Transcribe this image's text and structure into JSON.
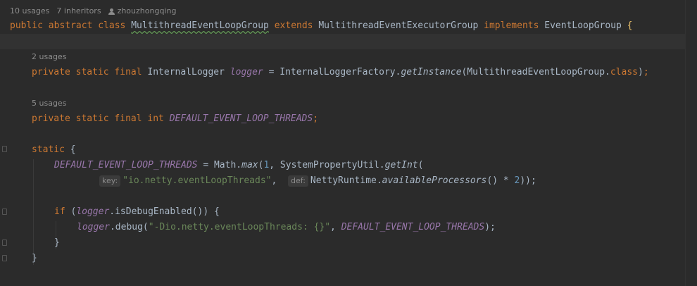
{
  "class_hint": {
    "usages": "10 usages",
    "inheritors": "7 inheritors",
    "author": "zhouzhongqing"
  },
  "class_decl": {
    "kw_public": "public",
    "kw_abstract": "abstract",
    "kw_class": "class",
    "class_name": "MultithreadEventLoopGroup",
    "kw_extends": "extends",
    "super_class": "MultithreadEventExecutorGroup",
    "kw_implements": "implements",
    "interface_name": "EventLoopGroup",
    "brace": "{"
  },
  "logger_field": {
    "hint": "2 usages",
    "kw_private": "private",
    "kw_static": "static",
    "kw_final": "final",
    "type": "InternalLogger",
    "name": "logger",
    "eq": " = ",
    "factory": "InternalLoggerFactory.",
    "method": "getInstance",
    "args_pre": "(MultithreadEventLoopGroup.",
    "kw_class": "class",
    "args_post": ")",
    "semi": ";"
  },
  "threads_field": {
    "hint": "5 usages",
    "kw_private": "private",
    "kw_static": "static",
    "kw_final": "final",
    "kw_int": "int",
    "name": "DEFAULT_EVENT_LOOP_THREADS",
    "semi": ";"
  },
  "static_block": {
    "kw_static": "static",
    "brace_open": "{",
    "assign_field": "DEFAULT_EVENT_LOOP_THREADS",
    "assign_eq": " = Math.",
    "max_method": "max",
    "paren_open": "(",
    "num_one": "1",
    "comma1": ", SystemPropertyUtil.",
    "getint_method": "getInt",
    "paren_open2": "(",
    "key_label": "key:",
    "key_string": "\"io.netty.eventLoopThreads\"",
    "comma2": ", ",
    "def_label": "def:",
    "runtime_cls": "NettyRuntime.",
    "avail_method": "availableProcessors",
    "call_tail": "() * ",
    "num_two": "2",
    "close_tail": "));",
    "kw_if": "if",
    "if_open": " (",
    "if_logger": "logger",
    "if_call": ".isDebugEnabled()) {",
    "debug_logger": "logger",
    "debug_call": ".debug(",
    "debug_string": "\"-Dio.netty.eventLoopThreads: {}\"",
    "debug_comma": ", ",
    "debug_field": "DEFAULT_EVENT_LOOP_THREADS",
    "debug_close": ");",
    "if_close": "}",
    "brace_close": "}"
  }
}
